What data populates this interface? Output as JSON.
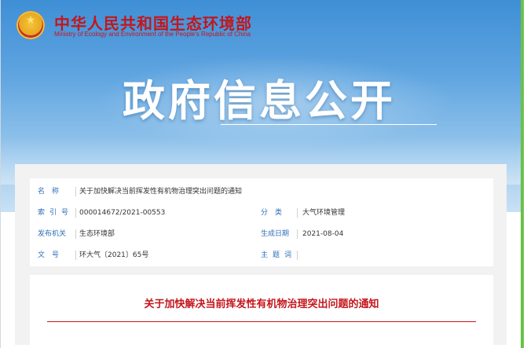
{
  "header": {
    "ministry_cn": "中华人民共和国生态环境部",
    "ministry_en": "Ministry of Ecology and Environment of the People's Republic of China",
    "banner_title": "政府信息公开"
  },
  "info": {
    "name_label": "名　称",
    "name_value": "关于加快解决当前挥发性有机物治理突出问题的通知",
    "index_label": "索引号",
    "index_value": "000014672/2021-00553",
    "category_label": "分　类",
    "category_value": "大气环境管理",
    "issuer_label": "发布机关",
    "issuer_value": "生态环境部",
    "date_label": "生成日期",
    "date_value": "2021-08-04",
    "docno_label": "文　号",
    "docno_value": "环大气〔2021〕65号",
    "keywords_label": "主题词",
    "keywords_value": ""
  },
  "document": {
    "title": "关于加快解决当前挥发性有机物治理突出问题的通知"
  },
  "colors": {
    "brand_red": "#c4161c",
    "label_blue": "#2f6fb8",
    "accent_green": "#6cc14a"
  }
}
